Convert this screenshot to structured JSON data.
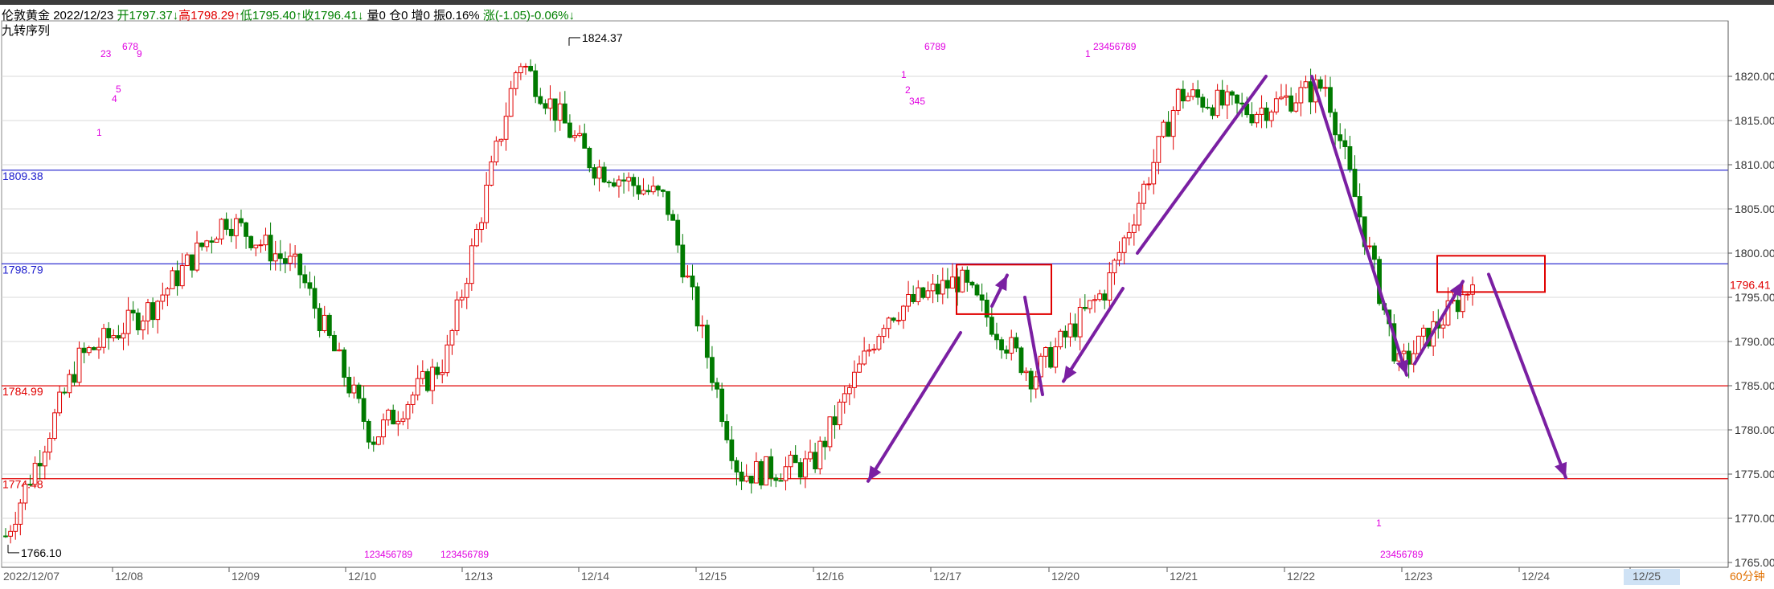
{
  "header": {
    "symbol": "伦敦黄金",
    "date": "2022/12/23",
    "open": "开1797.37↓",
    "high": "高1798.29↑",
    "low": "低1795.40↑",
    "close": "收1796.41↓",
    "volume": "量0",
    "position": "仓0",
    "increase": "增0",
    "amplitude": "振0.16%",
    "change": "涨(-1.05)-0.06%↓"
  },
  "indicator_label": "九转序列",
  "period_label": "60分钟",
  "colors": {
    "up": "#e00000",
    "down": "#007a00",
    "support_line": "#e00000",
    "resistance_line": "#1a1acc",
    "annotation_arrow": "#7a1fa2",
    "box": "#e00000",
    "td_count": "#e000e0"
  },
  "chart_data": {
    "type": "candlestick",
    "y_axis": {
      "min": 1765,
      "max": 1825,
      "ticks": [
        "1820.00",
        "1815.00",
        "1810.00",
        "1805.00",
        "1800.00",
        "1795.00",
        "1790.00",
        "1785.00",
        "1780.00",
        "1775.00",
        "1770.00",
        "1765.00"
      ],
      "last_price_label": "1796.41"
    },
    "x_axis": {
      "start_label": "2022/12/07",
      "ticks": [
        "12/08",
        "12/09",
        "12/10",
        "12/13",
        "12/14",
        "12/15",
        "12/16",
        "12/17",
        "12/20",
        "12/21",
        "12/22",
        "12/23",
        "12/24",
        "12/25"
      ]
    },
    "horizontal_lines": [
      {
        "label": "1809.38",
        "value": 1809.38,
        "kind": "resistance"
      },
      {
        "label": "1798.79",
        "value": 1798.79,
        "kind": "resistance"
      },
      {
        "label": "1784.99",
        "value": 1784.99,
        "kind": "support"
      },
      {
        "label": "1774.48",
        "value": 1774.48,
        "kind": "support"
      }
    ],
    "extremes": [
      {
        "label": "1824.37",
        "value": 1824.37,
        "type": "high"
      },
      {
        "label": "1766.10",
        "value": 1766.1,
        "type": "low"
      }
    ],
    "td_sequence_labels": [
      "23",
      "678",
      "9",
      "5",
      "4",
      "1",
      "6789",
      "1",
      "2",
      "345",
      "1",
      "23456789",
      "123456789",
      "123456789",
      "1",
      "23456789"
    ],
    "key_points": [
      {
        "x": "12/07",
        "close": 1768
      },
      {
        "x": "12/08",
        "close": 1788
      },
      {
        "x": "12/09",
        "close": 1794
      },
      {
        "x": "12/09",
        "close": 1804
      },
      {
        "x": "12/10",
        "close": 1798
      },
      {
        "x": "12/13",
        "close": 1779
      },
      {
        "x": "12/13",
        "close": 1788
      },
      {
        "x": "12/14",
        "close": 1822
      },
      {
        "x": "12/14",
        "close": 1810
      },
      {
        "x": "12/15",
        "close": 1806
      },
      {
        "x": "12/15",
        "close": 1775
      },
      {
        "x": "12/16",
        "close": 1776
      },
      {
        "x": "12/17",
        "close": 1793
      },
      {
        "x": "12/17",
        "close": 1797
      },
      {
        "x": "12/20",
        "close": 1786
      },
      {
        "x": "12/20",
        "close": 1796
      },
      {
        "x": "12/21",
        "close": 1818
      },
      {
        "x": "12/22",
        "close": 1816
      },
      {
        "x": "12/22",
        "close": 1819
      },
      {
        "x": "12/23",
        "close": 1787
      },
      {
        "x": "12/23",
        "close": 1796.41
      }
    ]
  }
}
